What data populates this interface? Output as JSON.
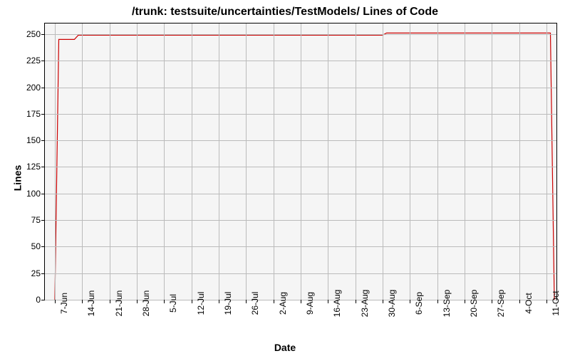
{
  "chart_data": {
    "type": "line",
    "title": "/trunk: testsuite/uncertainties/TestModels/ Lines of Code",
    "xlabel": "Date",
    "ylabel": "Lines",
    "ylim": [
      0,
      260
    ],
    "y_ticks": [
      0,
      25,
      50,
      75,
      100,
      125,
      150,
      175,
      200,
      225,
      250
    ],
    "x_ticks": [
      "7-Jun",
      "14-Jun",
      "21-Jun",
      "28-Jun",
      "5-Jul",
      "12-Jul",
      "19-Jul",
      "26-Jul",
      "2-Aug",
      "9-Aug",
      "16-Aug",
      "23-Aug",
      "30-Aug",
      "6-Sep",
      "13-Sep",
      "20-Sep",
      "27-Sep",
      "4-Oct",
      "11-Oct"
    ],
    "series": [
      {
        "name": "Lines of Code",
        "color": "#cc0000",
        "points": [
          {
            "x": "7-Jun",
            "y": 0
          },
          {
            "x": "8-Jun",
            "y": 245
          },
          {
            "x": "12-Jun",
            "y": 245
          },
          {
            "x": "13-Jun",
            "y": 249
          },
          {
            "x": "30-Aug",
            "y": 249
          },
          {
            "x": "31-Aug",
            "y": 251
          },
          {
            "x": "12-Oct",
            "y": 251
          },
          {
            "x": "13-Oct",
            "y": 0
          }
        ]
      }
    ]
  }
}
